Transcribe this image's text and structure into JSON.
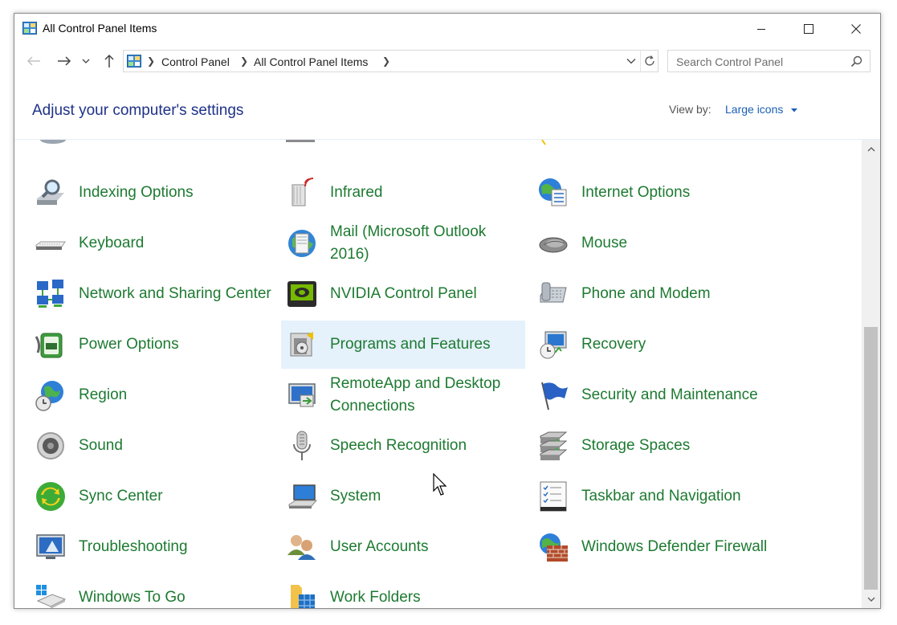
{
  "window": {
    "title": "All Control Panel Items"
  },
  "address": {
    "crumbs": [
      "Control Panel",
      "All Control Panel Items"
    ]
  },
  "search": {
    "placeholder": "Search Control Panel"
  },
  "header": {
    "heading": "Adjust your computer's settings",
    "view_by_label": "View by:",
    "view_by_value": "Large icons"
  },
  "items": [
    {
      "label": "Indexing Options",
      "icon": "indexing-options-icon"
    },
    {
      "label": "Infrared",
      "icon": "infrared-icon"
    },
    {
      "label": "Internet Options",
      "icon": "internet-options-icon"
    },
    {
      "label": "Keyboard",
      "icon": "keyboard-icon"
    },
    {
      "label": "Mail (Microsoft Outlook 2016)",
      "icon": "mail-icon"
    },
    {
      "label": "Mouse",
      "icon": "mouse-icon"
    },
    {
      "label": "Network and Sharing Center",
      "icon": "network-icon"
    },
    {
      "label": "NVIDIA Control Panel",
      "icon": "nvidia-icon"
    },
    {
      "label": "Phone and Modem",
      "icon": "phone-modem-icon"
    },
    {
      "label": "Power Options",
      "icon": "power-options-icon"
    },
    {
      "label": "Programs and Features",
      "icon": "programs-features-icon"
    },
    {
      "label": "Recovery",
      "icon": "recovery-icon"
    },
    {
      "label": "Region",
      "icon": "region-icon"
    },
    {
      "label": "RemoteApp and Desktop Connections",
      "icon": "remoteapp-icon"
    },
    {
      "label": "Security and Maintenance",
      "icon": "security-flag-icon"
    },
    {
      "label": "Sound",
      "icon": "sound-icon"
    },
    {
      "label": "Speech Recognition",
      "icon": "microphone-icon"
    },
    {
      "label": "Storage Spaces",
      "icon": "storage-spaces-icon"
    },
    {
      "label": "Sync Center",
      "icon": "sync-center-icon"
    },
    {
      "label": "System",
      "icon": "system-icon"
    },
    {
      "label": "Taskbar and Navigation",
      "icon": "taskbar-icon"
    },
    {
      "label": "Troubleshooting",
      "icon": "troubleshooting-icon"
    },
    {
      "label": "User Accounts",
      "icon": "user-accounts-icon"
    },
    {
      "label": "Windows Defender Firewall",
      "icon": "firewall-icon"
    },
    {
      "label": "Windows To Go",
      "icon": "windows-to-go-icon"
    },
    {
      "label": "Work Folders",
      "icon": "work-folders-icon"
    }
  ],
  "colors": {
    "item_text": "#1d7a31",
    "heading": "#1e3287",
    "link": "#1a5fb4",
    "hover_bg": "#e5f1fb"
  }
}
